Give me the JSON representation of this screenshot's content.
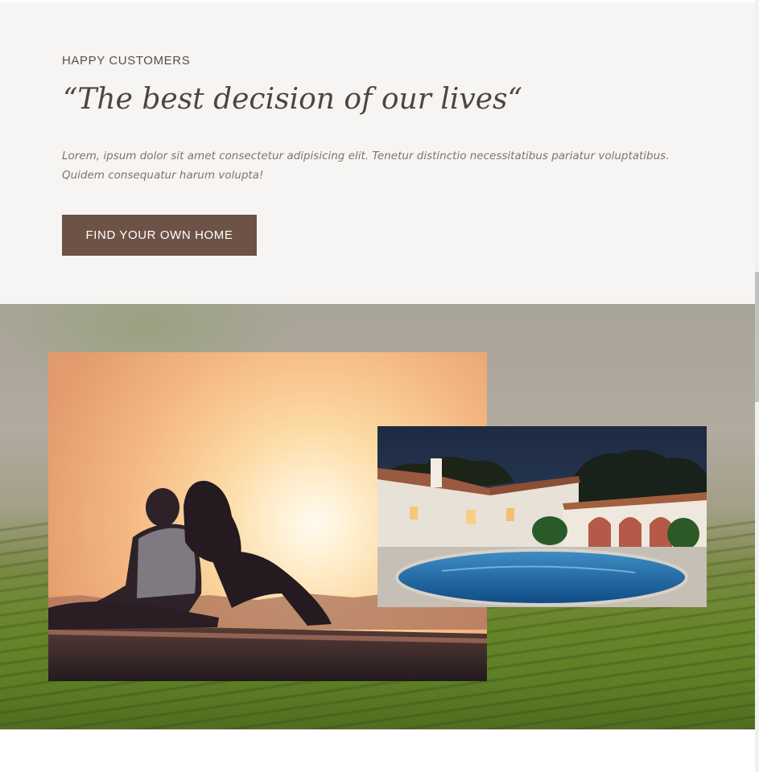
{
  "testimonial": {
    "eyebrow": "HAPPY CUSTOMERS",
    "quote": "“The best decision of our lives“",
    "body": "Lorem, ipsum dolor sit amet consectetur adipisicing elit. Tenetur distinctio necessitatibus pariatur voluptatibus. Quidem consequatur harum volupta!",
    "cta_label": "FIND YOUR OWN HOME"
  },
  "colors": {
    "section_bg": "#f7f5f3",
    "cta_bg": "#6d5346",
    "heading": "#4a4642",
    "body_text": "#7b756e"
  },
  "hero": {
    "background": "tea-plantation-photo",
    "photos": [
      "couple-sunset-photo",
      "villa-pool-night-photo"
    ]
  }
}
